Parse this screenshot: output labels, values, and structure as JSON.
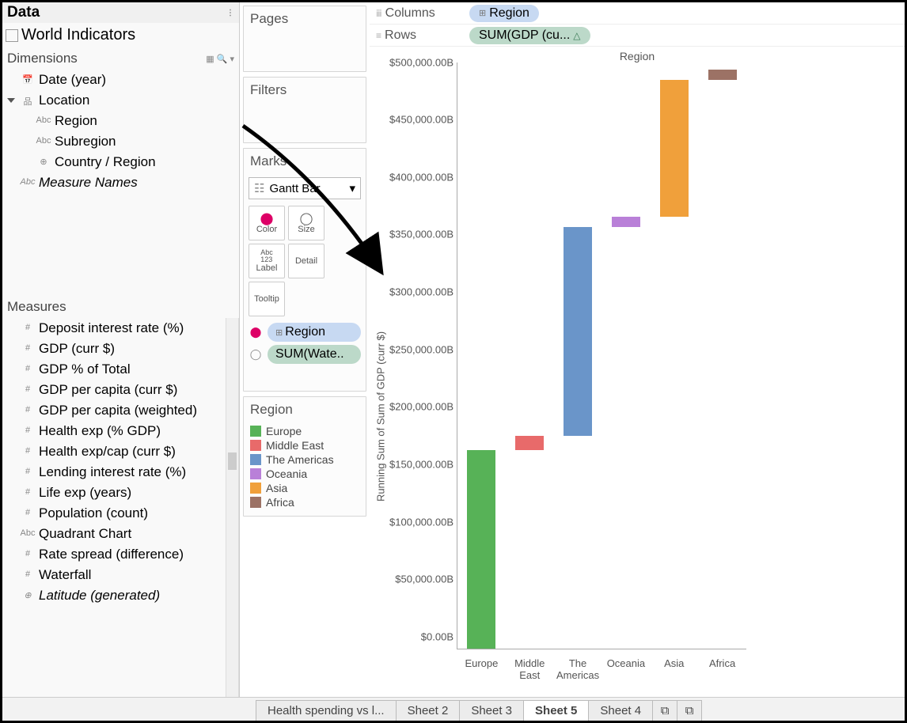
{
  "data_panel": {
    "header": "Data",
    "datasource": "World Indicators",
    "dimensions_label": "Dimensions",
    "dimensions": {
      "date": "Date (year)",
      "location": "Location",
      "region": "Region",
      "subregion": "Subregion",
      "country": "Country / Region",
      "measure_names": "Measure Names"
    },
    "measures_label": "Measures",
    "measures": [
      "Deposit interest rate (%)",
      "GDP (curr $)",
      "GDP % of Total",
      "GDP per capita (curr $)",
      "GDP per capita (weighted)",
      "Health exp (% GDP)",
      "Health exp/cap (curr $)",
      "Lending interest rate (%)",
      "Life exp (years)",
      "Population (count)",
      "Quadrant Chart",
      "Rate spread (difference)",
      "Waterfall",
      "Latitude (generated)"
    ]
  },
  "shelves": {
    "pages": "Pages",
    "filters": "Filters",
    "marks": "Marks",
    "mark_type": "Gantt Bar",
    "btn_color": "Color",
    "btn_size": "Size",
    "btn_label": "Label",
    "btn_detail": "Detail",
    "btn_tooltip": "Tooltip",
    "pill_region": "Region",
    "pill_sum": "SUM(Wate..",
    "legend_title": "Region",
    "legend": [
      {
        "label": "Europe",
        "color": "#57b257"
      },
      {
        "label": "Middle East",
        "color": "#e86a6a"
      },
      {
        "label": "The Americas",
        "color": "#6a95c9"
      },
      {
        "label": "Oceania",
        "color": "#b980d8"
      },
      {
        "label": "Asia",
        "color": "#f0a03b"
      },
      {
        "label": "Africa",
        "color": "#9c7265"
      }
    ]
  },
  "columns": {
    "label": "Columns",
    "pill": "Region"
  },
  "rows": {
    "label": "Rows",
    "pill": "SUM(GDP (cu..."
  },
  "chart_data": {
    "type": "bar",
    "title": "Region",
    "ylabel": "Running Sum of Sum of GDP (curr $)",
    "ylim": [
      0,
      510000
    ],
    "yticks": [
      "$0.00B",
      "$50,000.00B",
      "$100,000.00B",
      "$150,000.00B",
      "$200,000.00B",
      "$250,000.00B",
      "$300,000.00B",
      "$350,000.00B",
      "$400,000.00B",
      "$450,000.00B",
      "$500,000.00B"
    ],
    "categories": [
      "Europe",
      "Middle East",
      "The Americas",
      "Oceania",
      "Asia",
      "Africa"
    ],
    "series": [
      {
        "name": "Europe",
        "start": 0,
        "end": 173000,
        "color": "#57b257"
      },
      {
        "name": "Middle East",
        "start": 173000,
        "end": 185000,
        "color": "#e86a6a"
      },
      {
        "name": "The Americas",
        "start": 185000,
        "end": 367000,
        "color": "#6a95c9"
      },
      {
        "name": "Oceania",
        "start": 367000,
        "end": 376000,
        "color": "#b980d8"
      },
      {
        "name": "Asia",
        "start": 376000,
        "end": 495000,
        "color": "#f0a03b"
      },
      {
        "name": "Africa",
        "start": 495000,
        "end": 504000,
        "color": "#9c7265"
      }
    ]
  },
  "tabs": [
    "Health spending vs l...",
    "Sheet 2",
    "Sheet 3",
    "Sheet 5",
    "Sheet 4"
  ],
  "active_tab": "Sheet 5"
}
